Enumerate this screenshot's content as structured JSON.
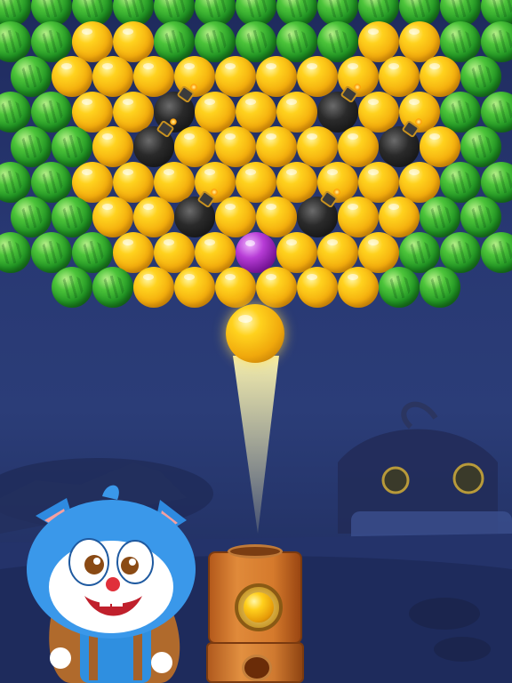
{
  "game": {
    "board_rows": [
      [
        "green",
        "green",
        "green",
        "green",
        "green",
        "green",
        "green",
        "green",
        "green",
        "green",
        "green",
        "green",
        "green"
      ],
      [
        "green",
        "green",
        "orange",
        "orange",
        "green",
        "green",
        "green",
        "green",
        "green",
        "orange",
        "orange",
        "green",
        "green"
      ],
      [
        "green",
        "orange",
        "orange",
        "orange",
        "orange",
        "orange",
        "orange",
        "orange",
        "orange",
        "orange",
        "orange",
        "green"
      ],
      [
        "green",
        "green",
        "orange",
        "orange",
        "bomb",
        "orange",
        "orange",
        "orange",
        "bomb",
        "orange",
        "orange",
        "green",
        "green"
      ],
      [
        "green",
        "green",
        "orange",
        "bomb",
        "orange",
        "orange",
        "orange",
        "orange",
        "orange",
        "bomb",
        "orange",
        "green"
      ],
      [
        "green",
        "green",
        "orange",
        "orange",
        "orange",
        "orange",
        "orange",
        "orange",
        "orange",
        "orange",
        "orange",
        "green",
        "green"
      ],
      [
        "green",
        "green",
        "orange",
        "orange",
        "bomb",
        "orange",
        "orange",
        "bomb",
        "orange",
        "orange",
        "green",
        "green"
      ],
      [
        "green",
        "green",
        "green",
        "orange",
        "orange",
        "orange",
        "purple",
        "orange",
        "orange",
        "orange",
        "green",
        "green",
        "green"
      ],
      [
        "green",
        "green",
        "orange",
        "orange",
        "orange",
        "orange",
        "orange",
        "orange",
        "green",
        "green"
      ]
    ],
    "next_bubble": "orange",
    "loaded_bubble": "orange"
  },
  "colors": {
    "green": "#2aa52a",
    "orange": "#f7b711",
    "purple": "#9b2bbd",
    "bomb": "#1a1a1a",
    "background": "#283873"
  }
}
